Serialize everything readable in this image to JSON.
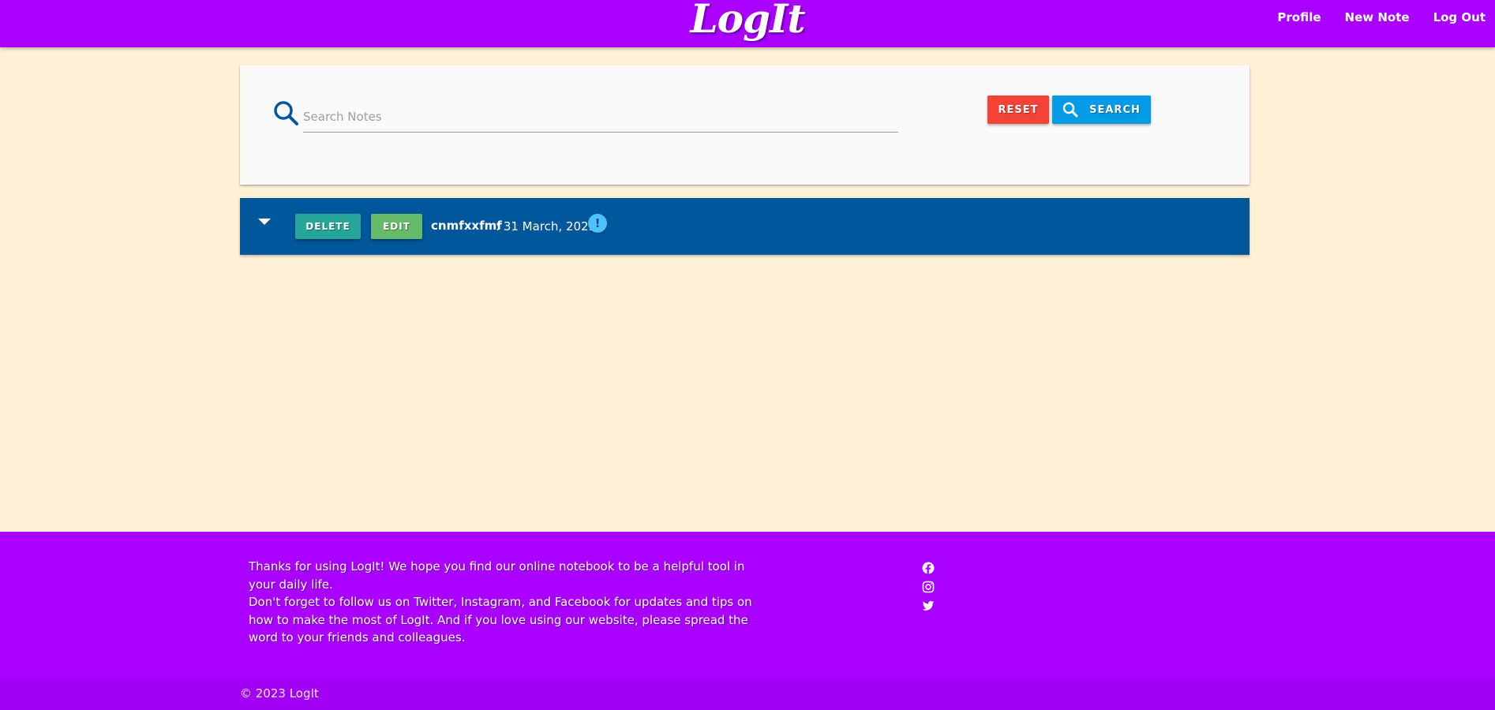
{
  "header": {
    "logo": "LogIt",
    "nav": [
      "Profile",
      "New Note",
      "Log Out"
    ]
  },
  "search": {
    "placeholder": "Search Notes",
    "value": "",
    "reset_label": "RESET",
    "search_label": "SEARCH"
  },
  "notes": [
    {
      "delete_label": "DELETE",
      "edit_label": "EDIT",
      "title": "cnmfxxfmf",
      "date": ": 31 March, 2023",
      "badge": "!"
    }
  ],
  "footer": {
    "line1": "Thanks for using LogIt! We hope you find our online notebook to be a helpful tool in your daily life.",
    "line2": "Don't forget to follow us on Twitter, Instagram, and Facebook for updates and tips on how to make the most of LogIt. And if you love using our website, please spread the word to your friends and colleagues.",
    "social": [
      "facebook-icon",
      "instagram-icon",
      "twitter-icon"
    ],
    "copyright": "© 2023 LogIt"
  },
  "colors": {
    "header": "#aa00ff",
    "background": "#fff0d6",
    "note_bar": "#01579b",
    "reset": "#f44336",
    "search": "#039be5",
    "delete": "#26a69a",
    "edit": "#66bb6a"
  }
}
